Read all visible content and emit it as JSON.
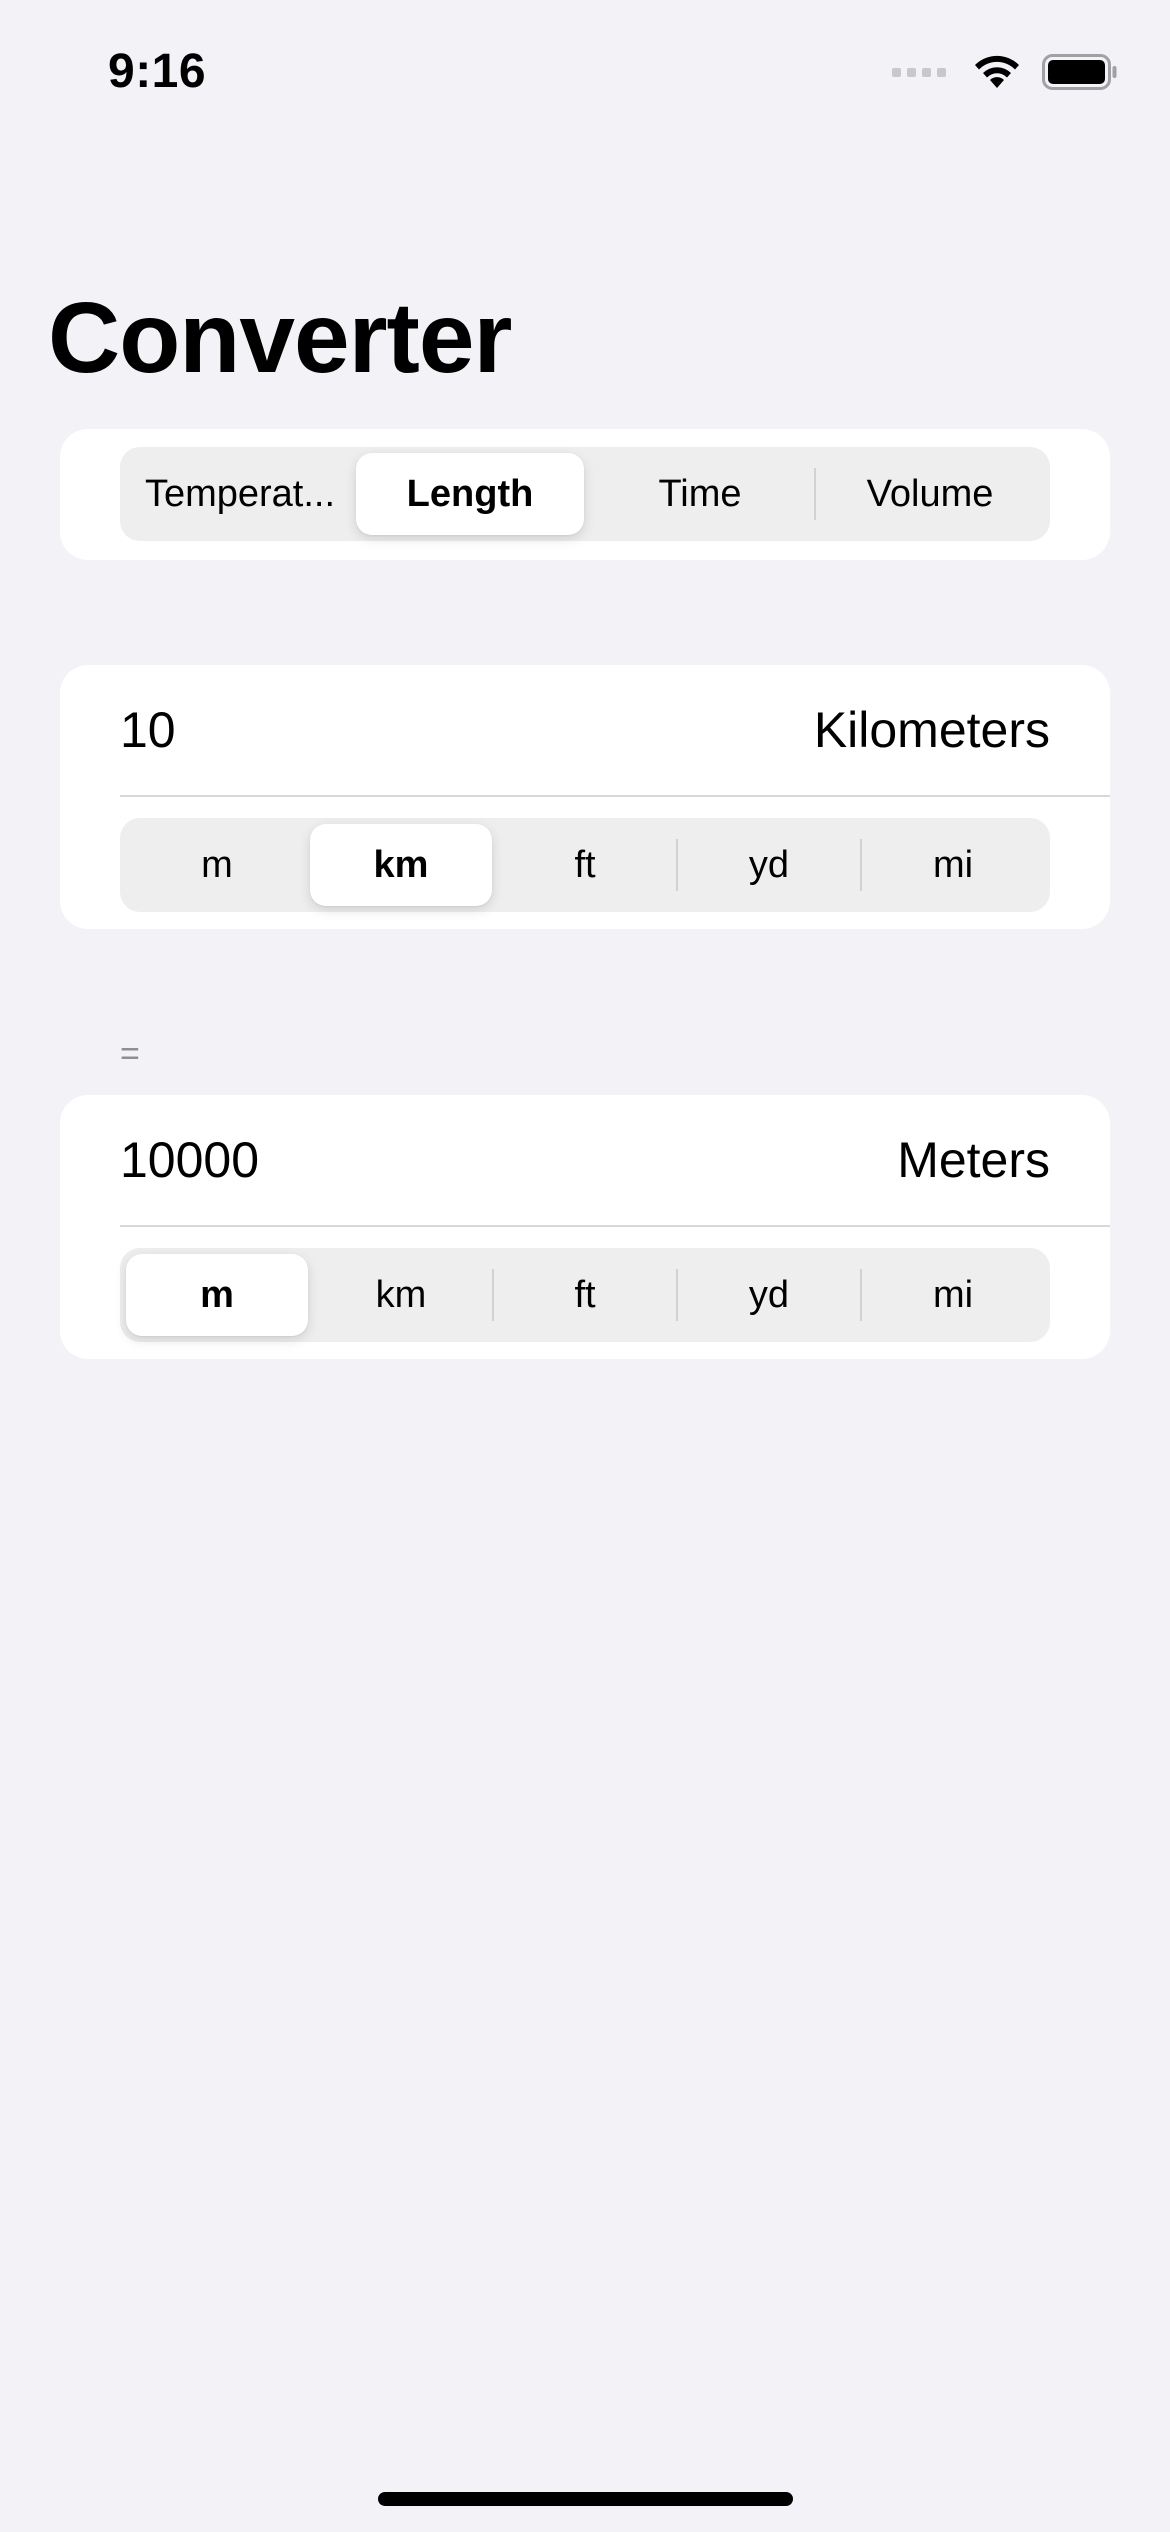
{
  "status_bar": {
    "time": "9:16"
  },
  "title": "Converter",
  "category_picker": {
    "options": [
      "Temperat...",
      "Length",
      "Time",
      "Volume"
    ],
    "selected": "Length"
  },
  "input": {
    "value": "10",
    "unit_name": "Kilometers",
    "units": [
      "m",
      "km",
      "ft",
      "yd",
      "mi"
    ],
    "selected": "km"
  },
  "equals": "=",
  "output": {
    "value": "10000",
    "unit_name": "Meters",
    "units": [
      "m",
      "km",
      "ft",
      "yd",
      "mi"
    ],
    "selected": "m"
  },
  "colors": {
    "background": "#f2f2f7",
    "card": "#ffffff",
    "segment_track": "#eeeeef",
    "secondary_text": "#8e8e93"
  }
}
